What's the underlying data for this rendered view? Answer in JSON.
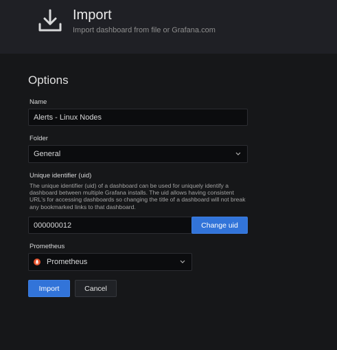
{
  "header": {
    "title": "Import",
    "subtitle": "Import dashboard from file or Grafana.com",
    "icon": "download-icon"
  },
  "options": {
    "title": "Options",
    "name": {
      "label": "Name",
      "value": "Alerts - Linux Nodes"
    },
    "folder": {
      "label": "Folder",
      "value": "General"
    },
    "uid": {
      "label": "Unique identifier (uid)",
      "description": "The unique identifier (uid) of a dashboard can be used for uniquely identify a dashboard between multiple Grafana installs. The uid allows having consistent URL's for accessing dashboards so changing the title of a dashboard will not break any bookmarked links to that dashboard.",
      "value": "000000012",
      "button": "Change uid"
    },
    "prometheus": {
      "label": "Prometheus",
      "value": "Prometheus",
      "icon": "prometheus-icon",
      "icon_color": "#e6522c"
    }
  },
  "actions": {
    "import": "Import",
    "cancel": "Cancel"
  },
  "colors": {
    "primary": "#3274d9",
    "background": "#161719",
    "header_background": "#1f2025"
  }
}
